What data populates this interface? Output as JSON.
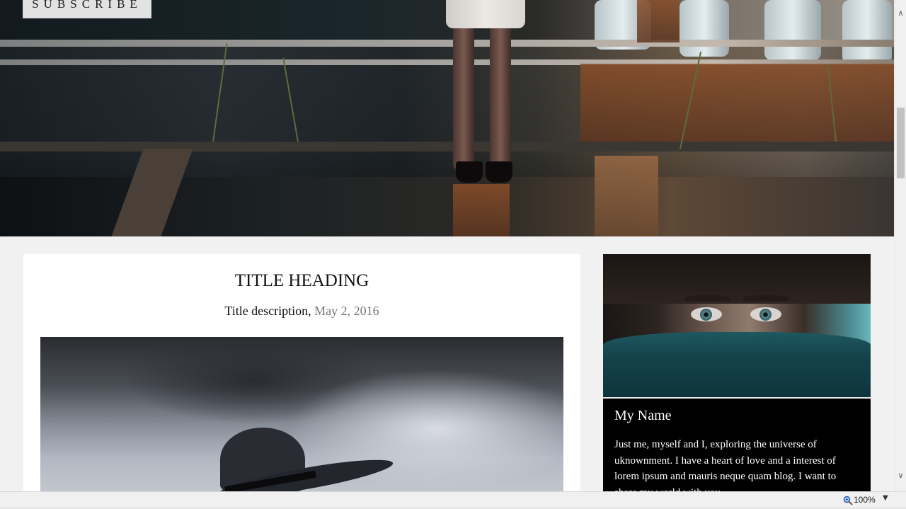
{
  "hero": {
    "subscribe_label": "SUBSCRIBE"
  },
  "article": {
    "title": "TITLE HEADING",
    "description": "Title description,",
    "date": "May 2, 2016"
  },
  "profile": {
    "name": "My Name",
    "bio": "Just me, myself and I, exploring the universe of uknownment. I have a heart of love and a interest of lorem ipsum and mauris neque quam blog. I want to share my world with you."
  },
  "scrollbar": {
    "up_icon": "chevron-up-icon",
    "down_icon": "chevron-down-icon",
    "up_glyph": "∧",
    "down_glyph": "∨"
  },
  "statusbar": {
    "zoom_level": "100%",
    "zoom_icon": "magnifier-icon",
    "dropdown_glyph": "▼"
  }
}
